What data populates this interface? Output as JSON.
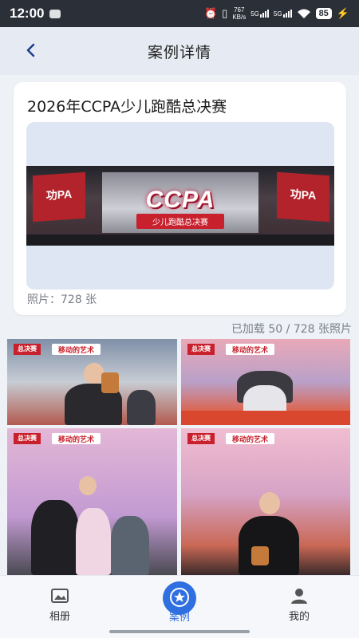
{
  "status_bar": {
    "time": "12:00",
    "net_speed_value": "767",
    "net_speed_unit": "KB/s",
    "sig1_label": "5G",
    "sig2_label": "5G",
    "battery": "85"
  },
  "header": {
    "title": "案例详情"
  },
  "case_card": {
    "title": "2026年CCPA少儿跑酷总决赛",
    "photo_count_label": "照片：728 张",
    "cover": {
      "flag_left": "功PA",
      "flag_right": "功PA",
      "logo": "CCPA",
      "subtitle": "少儿跑酷总决赛"
    }
  },
  "gallery": {
    "loaded_label": "已加载 50 / 728 张照片",
    "photos": [
      {
        "tag": "总决赛",
        "tag2": "移动的艺术"
      },
      {
        "tag": "总决赛",
        "tag2": "移动的艺术"
      },
      {
        "tag": "总决赛",
        "tag2": "移动的艺术"
      },
      {
        "tag": "总决赛",
        "tag2": "移动的艺术"
      }
    ]
  },
  "tabbar": {
    "tabs": [
      {
        "label": "相册",
        "icon": "album-icon"
      },
      {
        "label": "案例",
        "icon": "star-badge-icon"
      },
      {
        "label": "我的",
        "icon": "person-icon"
      }
    ],
    "active_index": 1
  },
  "colors": {
    "accent": "#2f6fe0",
    "header_bg": "#e6ebf3",
    "page_bg": "#eef1f6"
  }
}
